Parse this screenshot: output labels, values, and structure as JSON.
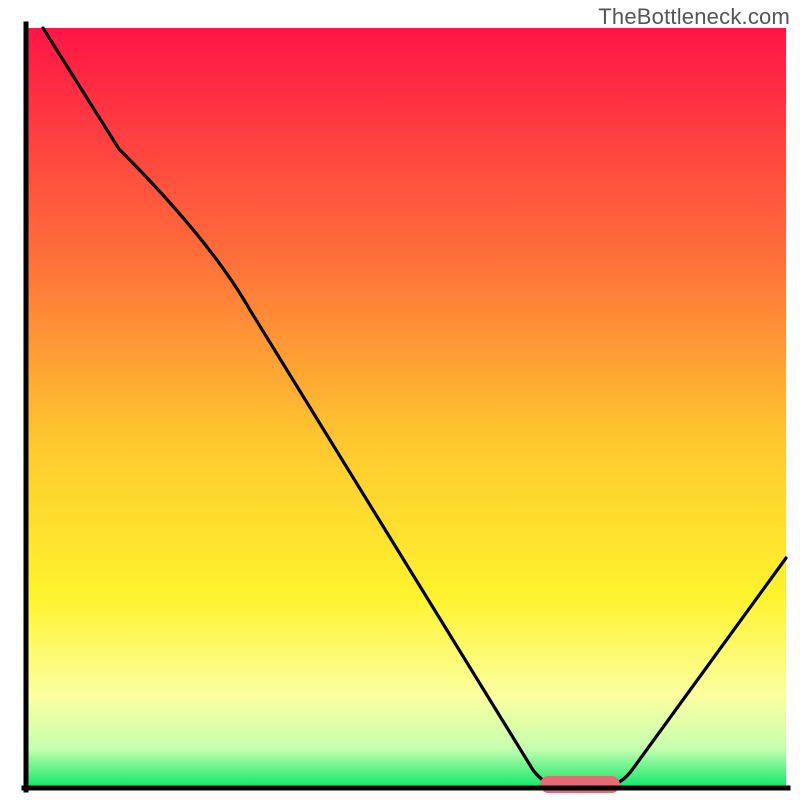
{
  "watermark": "TheBottleneck.com",
  "chart_data": {
    "type": "line",
    "title": "",
    "xlabel": "",
    "ylabel": "",
    "xlim": [
      0,
      100
    ],
    "ylim": [
      0,
      100
    ],
    "grid": false,
    "legend": false,
    "series": [
      {
        "name": "curve",
        "x": [
          2,
          12,
          24,
          68,
          78,
          100
        ],
        "y": [
          100,
          84,
          72,
          0,
          0,
          30
        ]
      }
    ],
    "marker": {
      "x_start": 68,
      "x_end": 78,
      "y": 0,
      "color": "#e46a74"
    },
    "background": {
      "type": "vertical-gradient",
      "stops": [
        {
          "pos": 0.0,
          "color": "#ff1546"
        },
        {
          "pos": 0.3,
          "color": "#ff6e3a"
        },
        {
          "pos": 0.55,
          "color": "#ffc92f"
        },
        {
          "pos": 0.75,
          "color": "#fff32e"
        },
        {
          "pos": 0.88,
          "color": "#fbffa0"
        },
        {
          "pos": 0.95,
          "color": "#c7ffb0"
        },
        {
          "pos": 1.0,
          "color": "#15e86d"
        }
      ]
    },
    "axes": {
      "color": "#000000",
      "width": 4
    }
  }
}
